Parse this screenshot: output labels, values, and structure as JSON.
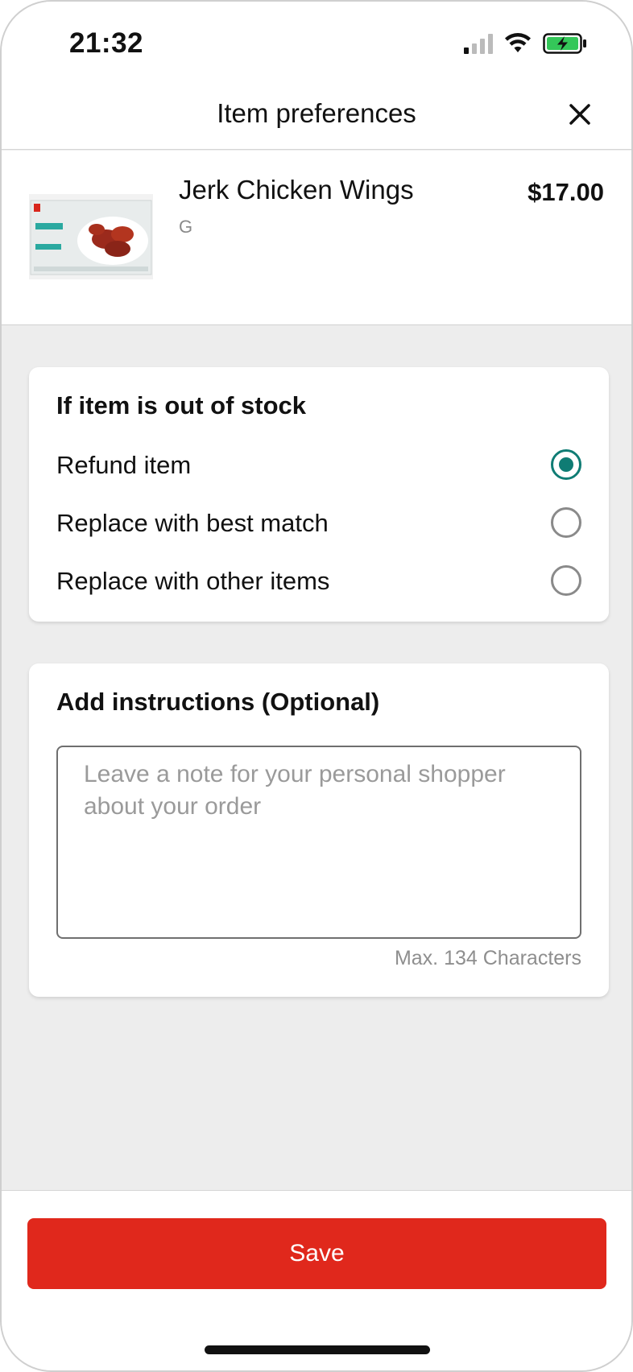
{
  "status_bar": {
    "time": "21:32"
  },
  "header": {
    "title": "Item preferences"
  },
  "product": {
    "name": "Jerk Chicken Wings",
    "subtitle": "G",
    "price": "$17.00"
  },
  "out_of_stock": {
    "title": "If item is out of stock",
    "options": [
      {
        "label": "Refund item",
        "selected": true
      },
      {
        "label": "Replace with best match",
        "selected": false
      },
      {
        "label": "Replace with other items",
        "selected": false
      }
    ]
  },
  "instructions": {
    "title": "Add instructions (Optional)",
    "value": "",
    "placeholder": "Leave a note for your personal shopper about your order",
    "char_limit": "Max. 134 Characters"
  },
  "footer": {
    "save_label": "Save"
  },
  "colors": {
    "accent_red": "#e0281c",
    "radio_teal": "#0f7c74",
    "background": "#ededed"
  }
}
